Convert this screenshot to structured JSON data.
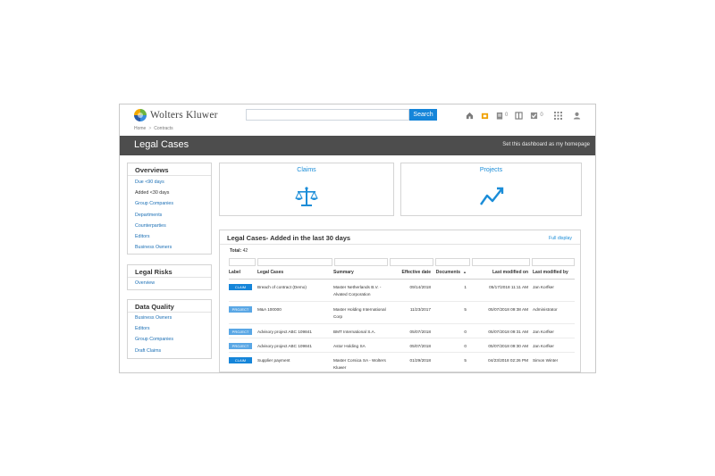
{
  "brand": "Wolters Kluwer",
  "search": {
    "placeholder": "",
    "button": "Search"
  },
  "header_icons": [
    {
      "name": "home-icon"
    },
    {
      "name": "briefcase-icon"
    },
    {
      "name": "clipboard-icon",
      "count": "0"
    },
    {
      "name": "book-icon"
    },
    {
      "name": "checkbox-icon",
      "count": "0"
    },
    {
      "name": "apps-grid-icon"
    },
    {
      "name": "user-icon"
    }
  ],
  "breadcrumb": [
    "Home",
    "Contracts"
  ],
  "page_title": "Legal Cases",
  "dashboard_link": "Set this dashboard as my homepage",
  "sidebar": {
    "overviews": {
      "title": "Overviews",
      "items": [
        "Due <90 days",
        "Added <30 days",
        "Group Companies",
        "Departments",
        "Counterparties",
        "Editors",
        "Business Owners"
      ]
    },
    "legal_risks": {
      "title": "Legal Risks",
      "items": [
        "Overview"
      ]
    },
    "data_quality": {
      "title": "Data Quality",
      "items": [
        "Business Owners",
        "Editors",
        "Group Companies",
        "Draft Claims"
      ]
    }
  },
  "tiles": {
    "claims": "Claims",
    "projects": "Projects"
  },
  "panel": {
    "title": "Legal Cases- Added in the last 30 days",
    "full_display": "Full display",
    "total_label": "Total:",
    "total_value": "42",
    "columns": [
      "Label",
      "Legal Cases",
      "Summary",
      "Effective date",
      "Documents",
      "Last modified on",
      "Last modified by"
    ],
    "rows": [
      {
        "label": "CLAIM",
        "kind": "claim",
        "case": "Breach of contract (Demo)",
        "summary": "Master Netherlands B.V. - Alvated Corporation",
        "date": "09/14/2018",
        "docs": "1",
        "modified_on": "05/17/2018 11:11 AM",
        "modified_by": "Jan Korfker"
      },
      {
        "label": "PROJECT",
        "kind": "project",
        "case": "M&A 100000",
        "summary": "Master Holding International Corp",
        "date": "11/23/2017",
        "docs": "5",
        "modified_on": "05/07/2018 09:38 AM",
        "modified_by": "Administrator"
      },
      {
        "label": "PROJECT",
        "kind": "project",
        "case": "Advisory project ABC 109841",
        "summary": "BMT International S.A.",
        "date": "05/07/2018",
        "docs": "0",
        "modified_on": "05/07/2018 09:31 AM",
        "modified_by": "Jan Korfker"
      },
      {
        "label": "PROJECT",
        "kind": "project",
        "case": "Advisory project ABC 109841",
        "summary": "Astor Holding SA",
        "date": "05/07/2018",
        "docs": "0",
        "modified_on": "05/07/2018 09:30 AM",
        "modified_by": "Jan Korfker"
      },
      {
        "label": "CLAIM",
        "kind": "claim",
        "case": "Supplier payment",
        "summary": "Master Corsica SA - Wolters Kluwer",
        "date": "01/29/2018",
        "docs": "5",
        "modified_on": "04/23/2018 02:26 PM",
        "modified_by": "Simon Winter"
      }
    ]
  }
}
